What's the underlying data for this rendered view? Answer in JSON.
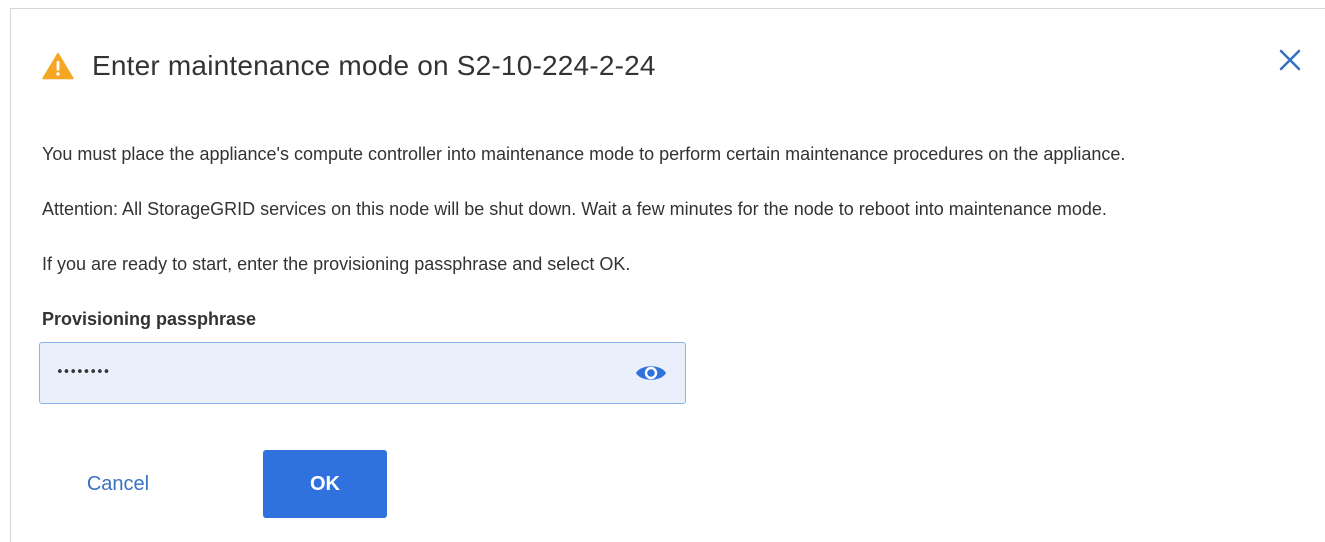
{
  "dialog": {
    "title": "Enter maintenance mode on S2-10-224-2-24",
    "paragraphs": [
      "You must place the appliance's compute controller into maintenance mode to perform certain maintenance procedures on the appliance.",
      "Attention: All StorageGRID services on this node will be shut down. Wait a few minutes for the node to reboot into maintenance mode.",
      "If you are ready to start, enter the provisioning passphrase and select OK."
    ],
    "field": {
      "label": "Provisioning passphrase",
      "value": "••••••••",
      "toggle_icon": "eye-icon"
    },
    "buttons": {
      "cancel_label": "Cancel",
      "ok_label": "OK"
    },
    "icons": {
      "header": "warning-icon",
      "close": "close-icon"
    },
    "colors": {
      "warning": "#f5a623",
      "primary": "#2f72de",
      "link": "#3a72c2",
      "input_bg": "#e9effb",
      "input_border": "#8ab4e8"
    }
  }
}
